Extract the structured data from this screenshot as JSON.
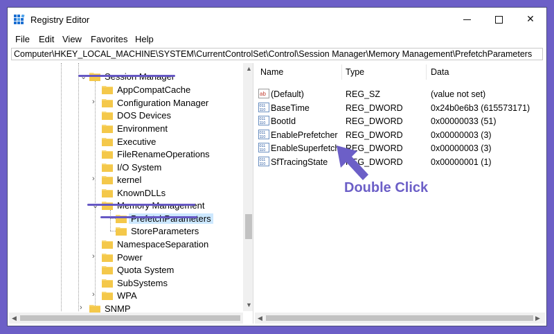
{
  "window": {
    "title": "Registry Editor"
  },
  "menu": [
    "File",
    "Edit",
    "View",
    "Favorites",
    "Help"
  ],
  "address": "Computer\\HKEY_LOCAL_MACHINE\\SYSTEM\\CurrentControlSet\\Control\\Session Manager\\Memory Management\\PrefetchParameters",
  "tree": {
    "items": [
      {
        "label": "Session Manager"
      },
      {
        "label": "AppCompatCache"
      },
      {
        "label": "Configuration Manager"
      },
      {
        "label": "DOS Devices"
      },
      {
        "label": "Environment"
      },
      {
        "label": "Executive"
      },
      {
        "label": "FileRenameOperations"
      },
      {
        "label": "I/O System"
      },
      {
        "label": "kernel"
      },
      {
        "label": "KnownDLLs"
      },
      {
        "label": "Memory Management"
      },
      {
        "label": "PrefetchParameters"
      },
      {
        "label": "StoreParameters"
      },
      {
        "label": "NamespaceSeparation"
      },
      {
        "label": "Power"
      },
      {
        "label": "Quota System"
      },
      {
        "label": "SubSystems"
      },
      {
        "label": "WPA"
      },
      {
        "label": "SNMP"
      }
    ]
  },
  "columns": {
    "name": "Name",
    "type": "Type",
    "data": "Data"
  },
  "values": [
    {
      "name": "(Default)",
      "type": "REG_SZ",
      "data": "(value not set)",
      "icon": "string-value-icon"
    },
    {
      "name": "BaseTime",
      "type": "REG_DWORD",
      "data": "0x24b0e6b3 (615573171)",
      "icon": "dword-value-icon"
    },
    {
      "name": "BootId",
      "type": "REG_DWORD",
      "data": "0x00000033 (51)",
      "icon": "dword-value-icon"
    },
    {
      "name": "EnablePrefetcher",
      "type": "REG_DWORD",
      "data": "0x00000003 (3)",
      "icon": "dword-value-icon"
    },
    {
      "name": "EnableSuperfetch",
      "type": "REG_DWORD",
      "data": "0x00000003 (3)",
      "icon": "dword-value-icon"
    },
    {
      "name": "SfTracingState",
      "type": "REG_DWORD",
      "data": "0x00000001 (1)",
      "icon": "dword-value-icon"
    }
  ],
  "annotation": {
    "label": "Double Click",
    "color": "#6c5fc7"
  },
  "colors": {
    "background": "#6c5fc7",
    "selection": "#cce8ff",
    "folder": "#f8d775",
    "underline": "#6658c4"
  }
}
